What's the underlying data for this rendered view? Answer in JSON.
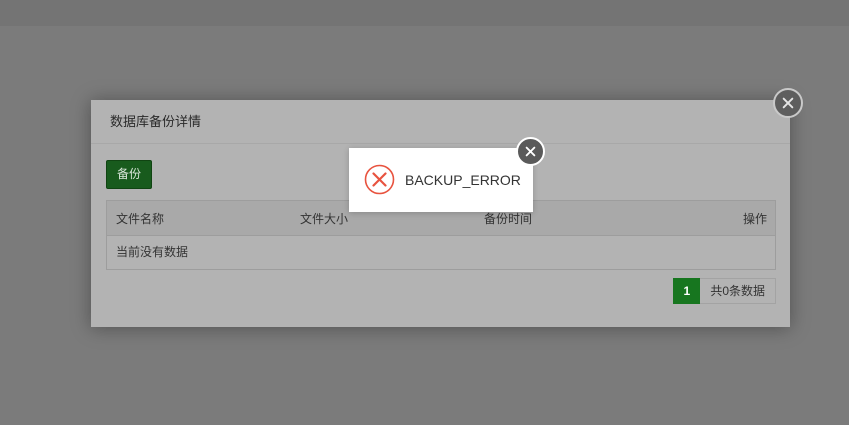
{
  "dialog": {
    "title": "数据库备份详情",
    "backup_label": "备份",
    "table": {
      "headers": [
        "文件名称",
        "文件大小",
        "备份时间",
        "操作"
      ],
      "empty_text": "当前没有数据"
    },
    "pager": {
      "current_page": "1",
      "total_text": "共0条数据"
    }
  },
  "toast": {
    "message": "BACKUP_ERROR"
  },
  "colors": {
    "overlay": "#7b7b7b",
    "accent_green": "#17761f",
    "error_red": "#e8533f"
  }
}
